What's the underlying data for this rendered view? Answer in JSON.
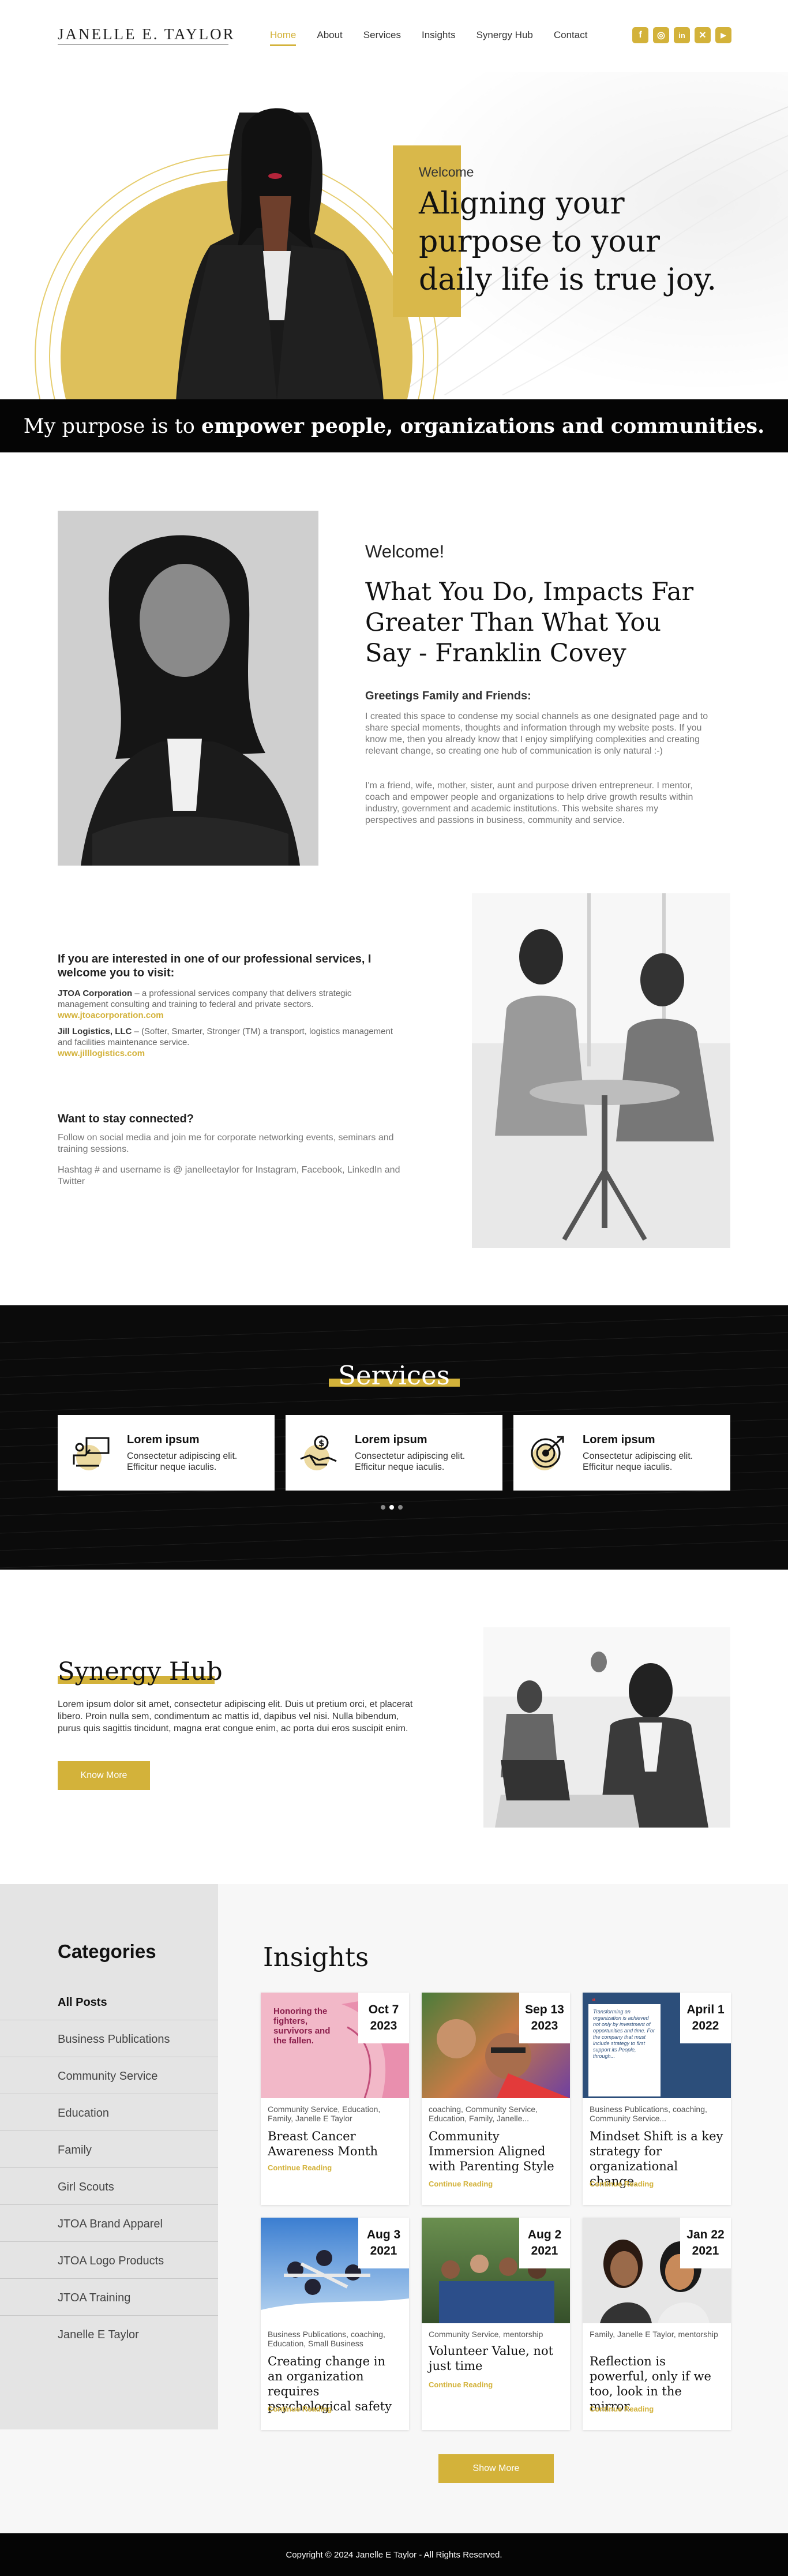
{
  "brand": {
    "logo": "JANELLE E. TAYLOR",
    "accent": "#d3b23a"
  },
  "nav": [
    {
      "label": "Home",
      "active": true
    },
    {
      "label": "About"
    },
    {
      "label": "Services"
    },
    {
      "label": "Insights"
    },
    {
      "label": "Synergy Hub"
    },
    {
      "label": "Contact"
    }
  ],
  "social": [
    {
      "icon": "facebook-icon",
      "glyph": "f"
    },
    {
      "icon": "instagram-icon",
      "glyph": "◎"
    },
    {
      "icon": "linkedin-icon",
      "glyph": "in"
    },
    {
      "icon": "x-icon",
      "glyph": "✕"
    },
    {
      "icon": "youtube-icon",
      "glyph": "▶"
    }
  ],
  "hero": {
    "welcome": "Welcome",
    "quote": "Aligning your purpose to your daily life is true joy."
  },
  "purpose": {
    "prefix": "My purpose is to ",
    "bold": "empower people, organizations and communities."
  },
  "welcome": {
    "title": "Welcome!",
    "quote": "What You Do, Impacts Far Greater Than What You Say - Franklin Covey",
    "greeting": "Greetings Family and Friends:",
    "p1": "I created this space to condense my social channels as one designated page and to share special moments, thoughts and information through my website posts.  If you know me, then you already know that I enjoy simplifying complexities and creating relevant change,  so creating one hub of communication is only natural :-)",
    "p2": "I'm a friend, wife, mother, sister,  aunt and purpose driven entrepreneur.  I mentor, coach and empower people and organizations to help drive growth results within industry, government and academic institutions.  This website shares my perspectives and passions in business, community and service."
  },
  "professional": {
    "intro": "If you are interested in one of our professional services, I welcome you to visit:",
    "items": [
      {
        "name": "JTOA Corporation",
        "desc": " – a professional services company that delivers strategic management consulting and training to federal and private sectors.",
        "link": "www.jtoacorporation.com"
      },
      {
        "name": "Jill Logistics, LLC",
        "desc": " – (Softer, Smarter, Stronger (TM) a transport, logistics management and facilities maintenance service.",
        "link": "www.jilllogistics.com"
      }
    ],
    "stay_title": "Want to stay connected?",
    "stay_p1": "Follow on social media and join me for corporate networking events, seminars and training sessions.",
    "stay_p2": "Hashtag # and username is @ janelleetaylor for Instagram, Facebook, LinkedIn and Twitter"
  },
  "services": {
    "title": "Services",
    "cards": [
      {
        "title": "Lorem ipsum",
        "desc": "Consectetur adipiscing elit. Efficitur neque iaculis.",
        "icon": "presentation-icon"
      },
      {
        "title": "Lorem ipsum",
        "desc": "Consectetur adipiscing elit. Efficitur neque iaculis.",
        "icon": "handshake-money-icon"
      },
      {
        "title": "Lorem ipsum",
        "desc": "Consectetur adipiscing elit. Efficitur neque iaculis.",
        "icon": "target-icon"
      }
    ]
  },
  "synergy": {
    "title": "Synergy Hub",
    "text": "Lorem ipsum dolor sit amet, consectetur adipiscing elit. Duis ut pretium orci, et placerat libero. Proin nulla sem, condimentum ac mattis id, dapibus vel nisi. Nulla bibendum, purus quis sagittis tincidunt, magna erat congue enim, ac porta dui eros suscipit enim.",
    "button": "Know More"
  },
  "categories": {
    "title": "Categories",
    "items": [
      "All Posts",
      "Business Publications",
      "Community Service",
      "Education",
      "Family",
      "Girl Scouts",
      "JTOA Brand Apparel",
      "JTOA Logo Products",
      "JTOA Training",
      "Janelle E Taylor"
    ]
  },
  "insights": {
    "title": "Insights",
    "more_label": "Continue Reading",
    "show_more": "Show More",
    "posts": [
      {
        "date1": "Oct 7",
        "date2": "2023",
        "tags": "Community Service, Education, Family, Janelle E Taylor",
        "title": "Breast Cancer Awareness Month",
        "img_text": "Honoring the fighters, survivors and the fallen."
      },
      {
        "date1": "Sep 13",
        "date2": "2023",
        "tags": "coaching, Community Service, Education, Family, Janelle...",
        "title": "Community Immersion Aligned with Parenting Style",
        "img_text": ""
      },
      {
        "date1": "April 1",
        "date2": "2022",
        "tags": "Business Publications, coaching, Community Service...",
        "title": "Mindset Shift is a key strategy for organizational change.",
        "img_text": "Transforming an organization is achieved not only by investment of opportunities and time. For the company that must include strategy to first support its People, through..."
      },
      {
        "date1": "Aug 3",
        "date2": "2021",
        "tags": "Business Publications, coaching, Education, Small Business",
        "title": "Creating change in an organization requires psychological safety",
        "img_text": ""
      },
      {
        "date1": "Aug 2",
        "date2": "2021",
        "tags": "Community Service, mentorship",
        "title": "Volunteer Value, not just time",
        "img_text": ""
      },
      {
        "date1": "Jan 22",
        "date2": "2021",
        "tags": "Family, Janelle E Taylor, mentorship",
        "title": "Reflection is powerful, only if we too, look in the mirror.",
        "img_text": ""
      }
    ]
  },
  "footer": {
    "text": "Copyright © 2024 Janelle E Taylor - All Rights Reserved."
  }
}
